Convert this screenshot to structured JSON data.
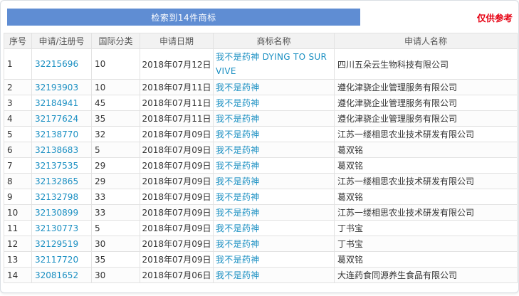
{
  "search_summary": "检索到14件商标",
  "reference_label": "仅供参考",
  "columns": [
    "序号",
    "申请/注册号",
    "国际分类",
    "申请日期",
    "商标名称",
    "申请人名称"
  ],
  "rows": [
    {
      "no": "1",
      "reg": "32215696",
      "cls": "10",
      "date": "2018年07月12日",
      "tm": "我不是药神 DYING TO SURVIVE",
      "applicant": "四川五朵云生物科技有限公司"
    },
    {
      "no": "2",
      "reg": "32193903",
      "cls": "10",
      "date": "2018年07月11日",
      "tm": "我不是药神",
      "applicant": "遵化津骁企业管理服务有限公司"
    },
    {
      "no": "3",
      "reg": "32184941",
      "cls": "45",
      "date": "2018年07月11日",
      "tm": "我不是药神",
      "applicant": "遵化津骁企业管理服务有限公司"
    },
    {
      "no": "4",
      "reg": "32177624",
      "cls": "35",
      "date": "2018年07月11日",
      "tm": "我不是药神",
      "applicant": "遵化津骁企业管理服务有限公司"
    },
    {
      "no": "5",
      "reg": "32138770",
      "cls": "32",
      "date": "2018年07月09日",
      "tm": "我不是药神",
      "applicant": "江苏一缕相思农业技术研发有限公司"
    },
    {
      "no": "6",
      "reg": "32138683",
      "cls": "5",
      "date": "2018年07月09日",
      "tm": "我不是药神",
      "applicant": "葛双铭"
    },
    {
      "no": "7",
      "reg": "32137535",
      "cls": "29",
      "date": "2018年07月09日",
      "tm": "我不是药神",
      "applicant": "葛双铭"
    },
    {
      "no": "8",
      "reg": "32132865",
      "cls": "29",
      "date": "2018年07月09日",
      "tm": "我不是药神",
      "applicant": "江苏一缕相思农业技术研发有限公司"
    },
    {
      "no": "9",
      "reg": "32132798",
      "cls": "33",
      "date": "2018年07月09日",
      "tm": "我不是药神",
      "applicant": "葛双铭"
    },
    {
      "no": "10",
      "reg": "32130899",
      "cls": "33",
      "date": "2018年07月09日",
      "tm": "我不是药神",
      "applicant": "江苏一缕相思农业技术研发有限公司"
    },
    {
      "no": "11",
      "reg": "32130773",
      "cls": "5",
      "date": "2018年07月09日",
      "tm": "我不是药神",
      "applicant": "丁书宝"
    },
    {
      "no": "12",
      "reg": "32129519",
      "cls": "30",
      "date": "2018年07月09日",
      "tm": "我不是药神",
      "applicant": "丁书宝"
    },
    {
      "no": "13",
      "reg": "32117720",
      "cls": "35",
      "date": "2018年07月09日",
      "tm": "我不是药神",
      "applicant": "葛双铭"
    },
    {
      "no": "14",
      "reg": "32081652",
      "cls": "30",
      "date": "2018年07月06日",
      "tm": "我不是药神",
      "applicant": "大连药食同源养生食品有限公司"
    }
  ],
  "colors": {
    "search_bar": "#5f8dd3",
    "link": "#1a8fc2",
    "reference": "#e60012",
    "header_bg": "#f2f2f2"
  }
}
